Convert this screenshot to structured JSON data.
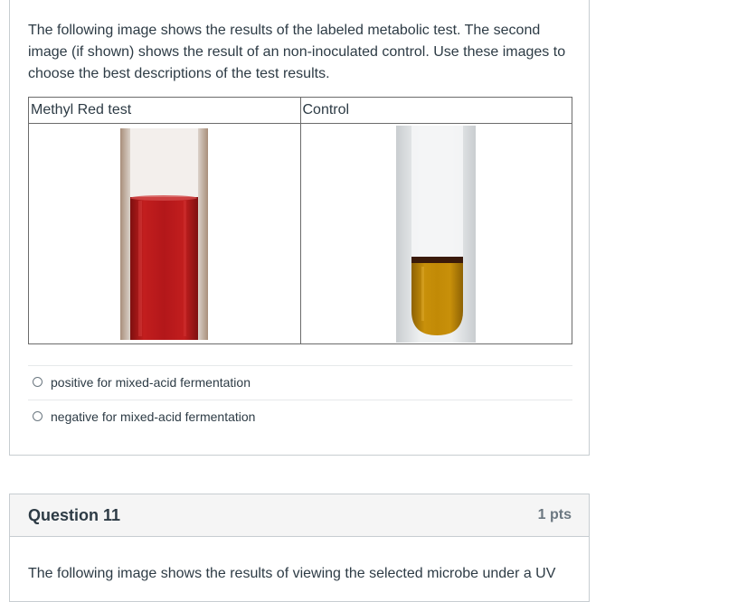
{
  "question10": {
    "prompt": "The following image shows the results of the labeled metabolic test. The second image (if shown) shows the result of an non-inoculated control.  Use these images to choose the best descriptions of the test results.",
    "table": {
      "headers": [
        "Methyl Red test",
        "Control"
      ]
    },
    "answers": [
      "positive for mixed-acid fermentation",
      "negative for mixed-acid fermentation"
    ]
  },
  "question11": {
    "title": "Question 11",
    "points": "1 pts",
    "prompt": "The following image shows the results of viewing the selected microbe under a UV"
  },
  "colors": {
    "methyl_red_liquid": "#b3171a",
    "control_liquid": "#c28a06",
    "border": "#c7cdd1",
    "header_bg": "#f5f5f5"
  },
  "icons": [
    "radio-button-icon"
  ]
}
